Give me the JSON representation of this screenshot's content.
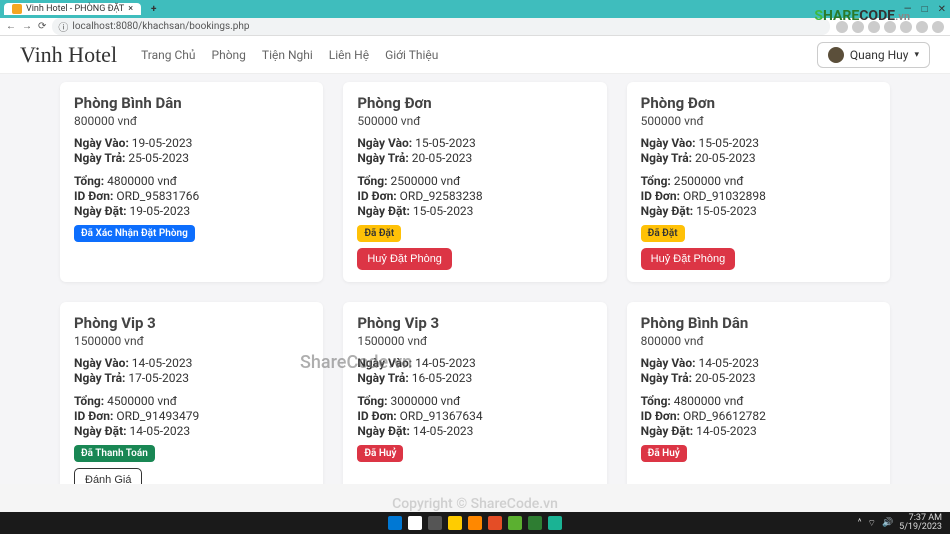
{
  "window": {
    "tab_title": "Vinh Hotel - PHÒNG ĐẶT",
    "minimize": "—",
    "maximize": "□",
    "close": "✕",
    "newtab": "+"
  },
  "browser": {
    "back": "←",
    "forward": "→",
    "reload": "⟳",
    "info": "ⓘ",
    "url": "localhost:8080/khachsan/bookings.php",
    "key_icon": "⌂"
  },
  "nav": {
    "brand": "Vinh Hotel",
    "links": [
      "Trang Chủ",
      "Phòng",
      "Tiện Nghi",
      "Liên Hệ",
      "Giới Thiệu"
    ],
    "username": "Quang Huy",
    "chev": "▾"
  },
  "labels": {
    "checkin": "Ngày Vào:",
    "checkout": "Ngày Trả:",
    "total": "Tổng:",
    "order_id": "ID Đơn:",
    "book_date": "Ngày Đặt:",
    "cancel": "Huỷ Đặt Phòng",
    "rate": "Đánh Giá"
  },
  "status": {
    "confirmed": "Đã Xác Nhận Đặt Phòng",
    "booked": "Đã Đặt",
    "paid": "Đã Thanh Toán",
    "canceled": "Đã Huỷ"
  },
  "bookings": [
    {
      "title": "Phòng Bình Dân",
      "price": "800000 vnđ",
      "checkin": "19-05-2023",
      "checkout": "25-05-2023",
      "total": "4800000 vnđ",
      "order": "ORD_95831766",
      "book_date": "19-05-2023",
      "status_key": "confirmed",
      "status_class": "badge-blue",
      "cancel": false,
      "rate": false
    },
    {
      "title": "Phòng Đơn",
      "price": "500000 vnđ",
      "checkin": "15-05-2023",
      "checkout": "20-05-2023",
      "total": "2500000 vnđ",
      "order": "ORD_92583238",
      "book_date": "15-05-2023",
      "status_key": "booked",
      "status_class": "badge-yellow",
      "cancel": true,
      "rate": false
    },
    {
      "title": "Phòng Đơn",
      "price": "500000 vnđ",
      "checkin": "15-05-2023",
      "checkout": "20-05-2023",
      "total": "2500000 vnđ",
      "order": "ORD_91032898",
      "book_date": "15-05-2023",
      "status_key": "booked",
      "status_class": "badge-yellow",
      "cancel": true,
      "rate": false
    },
    {
      "title": "Phòng Vip 3",
      "price": "1500000 vnđ",
      "checkin": "14-05-2023",
      "checkout": "17-05-2023",
      "total": "4500000 vnđ",
      "order": "ORD_91493479",
      "book_date": "14-05-2023",
      "status_key": "paid",
      "status_class": "badge-green",
      "cancel": false,
      "rate": true
    },
    {
      "title": "Phòng Vip 3",
      "price": "1500000 vnđ",
      "checkin": "14-05-2023",
      "checkout": "16-05-2023",
      "total": "3000000 vnđ",
      "order": "ORD_91367634",
      "book_date": "14-05-2023",
      "status_key": "canceled",
      "status_class": "badge-red",
      "cancel": false,
      "rate": false
    },
    {
      "title": "Phòng Bình Dân",
      "price": "800000 vnđ",
      "checkin": "14-05-2023",
      "checkout": "20-05-2023",
      "total": "4800000 vnđ",
      "order": "ORD_96612782",
      "book_date": "14-05-2023",
      "status_key": "canceled",
      "status_class": "badge-red",
      "cancel": false,
      "rate": false
    }
  ],
  "watermark": {
    "brand1": "S",
    "brand2": "HARE",
    "brand3": "CODE",
    "brand4": ".vn",
    "center": "ShareCode.vn",
    "copyright": "Copyright © ShareCode.vn"
  },
  "taskbar": {
    "time": "7:37 AM",
    "date": "5/19/2023",
    "tray_up": "^",
    "wifi": "⌔",
    "sound": "🔊",
    "icon_colors": [
      "#0078d4",
      "#fff",
      "#555",
      "#ffcc00",
      "#ff8800",
      "#e44d26",
      "#5bb030",
      "#2e7d32",
      "#1ab394"
    ]
  }
}
